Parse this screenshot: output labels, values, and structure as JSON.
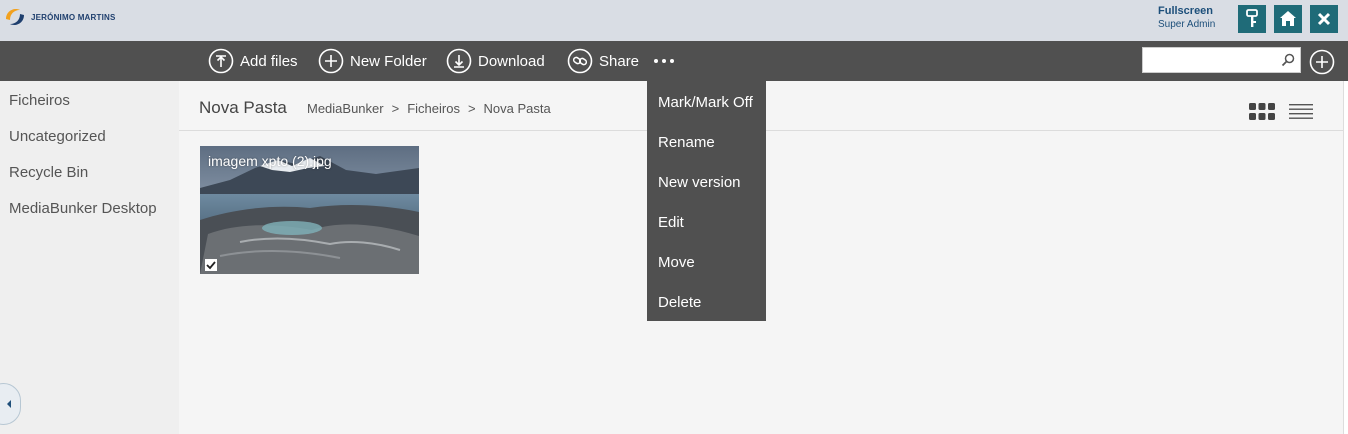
{
  "header": {
    "brand": "JERÓNIMO MARTINS",
    "fullscreen_label": "Fullscreen",
    "role": "Super Admin",
    "buttons": [
      "key-icon",
      "home-icon",
      "close-icon"
    ]
  },
  "toolbar": {
    "add_files": "Add files",
    "new_folder": "New Folder",
    "download": "Download",
    "share": "Share",
    "search_value": ""
  },
  "sidebar": {
    "items": [
      {
        "label": "Ficheiros"
      },
      {
        "label": "Uncategorized"
      },
      {
        "label": "Recycle Bin"
      },
      {
        "label": "MediaBunker Desktop"
      }
    ]
  },
  "main": {
    "title": "Nova Pasta",
    "breadcrumb": [
      "MediaBunker",
      ">",
      "Ficheiros",
      ">",
      "Nova Pasta"
    ],
    "files": [
      {
        "name": "imagem xpto (2).jpg",
        "checked": true
      }
    ]
  },
  "menu": {
    "items": [
      {
        "label": "Mark/Mark Off"
      },
      {
        "label": "Rename"
      },
      {
        "label": "New version"
      },
      {
        "label": "Edit"
      },
      {
        "label": "Move"
      },
      {
        "label": "Delete"
      }
    ]
  },
  "colors": {
    "toolbar": "#505050",
    "header": "#d9dde4",
    "accent_button": "#1f6b78",
    "brand_text": "#1f3f6e"
  }
}
